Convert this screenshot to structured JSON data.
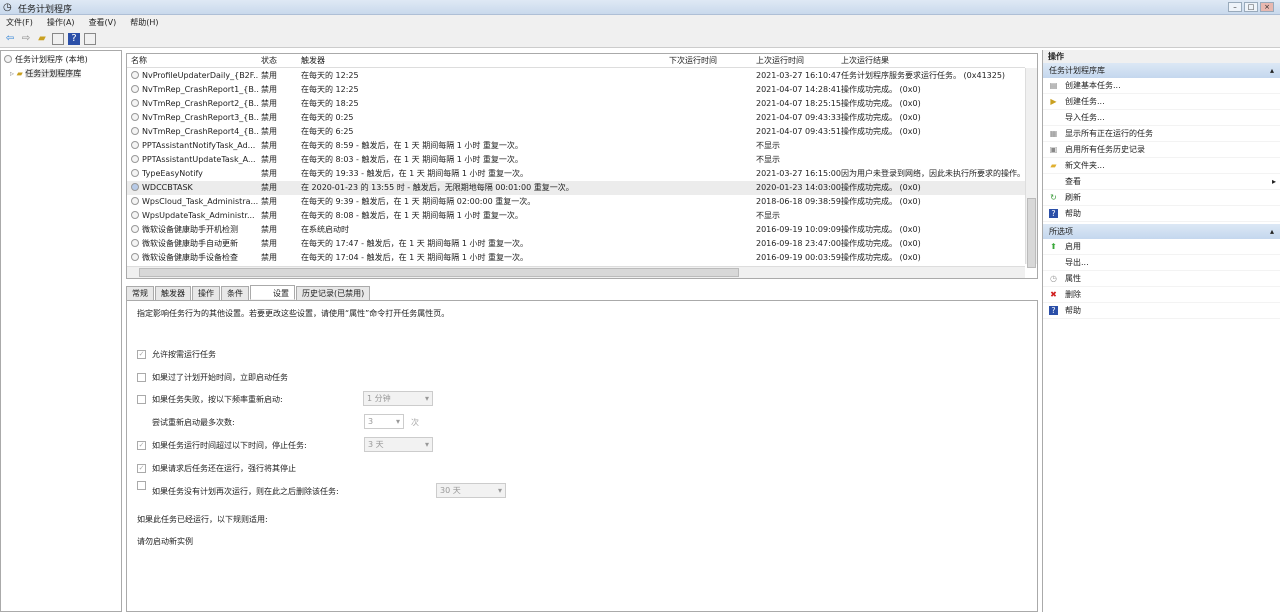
{
  "window": {
    "title": "任务计划程序"
  },
  "menu": [
    "文件(F)",
    "操作(A)",
    "查看(V)",
    "帮助(H)"
  ],
  "tree": {
    "root": "任务计划程序 (本地)",
    "child": "任务计划程序库"
  },
  "tasks": {
    "columns": [
      "名称",
      "状态",
      "触发器",
      "下次运行时间",
      "上次运行时间",
      "上次运行结果"
    ],
    "rows": [
      [
        "NvProfileUpdaterDaily_{B2F...",
        "禁用",
        "在每天的 12:25",
        "",
        "2021-03-27 16:10:47",
        "任务计划程序服务要求运行任务。 (0x41325)"
      ],
      [
        "NvTmRep_CrashReport1_{B...",
        "禁用",
        "在每天的 12:25",
        "",
        "2021-04-07 14:28:41",
        "操作成功完成。 (0x0)"
      ],
      [
        "NvTmRep_CrashReport2_{B...",
        "禁用",
        "在每天的 18:25",
        "",
        "2021-04-07 18:25:15",
        "操作成功完成。 (0x0)"
      ],
      [
        "NvTmRep_CrashReport3_{B...",
        "禁用",
        "在每天的 0:25",
        "",
        "2021-04-07 09:43:33",
        "操作成功完成。 (0x0)"
      ],
      [
        "NvTmRep_CrashReport4_{B...",
        "禁用",
        "在每天的 6:25",
        "",
        "2021-04-07 09:43:51",
        "操作成功完成。 (0x0)"
      ],
      [
        "PPTAssistantNotifyTask_Ad...",
        "禁用",
        "在每天的 8:59 - 触发后，在 1 天 期间每隔 1 小时 重复一次。",
        "",
        "不显示",
        ""
      ],
      [
        "PPTAssistantUpdateTask_A...",
        "禁用",
        "在每天的 8:03 - 触发后，在 1 天 期间每隔 1 小时 重复一次。",
        "",
        "不显示",
        ""
      ],
      [
        "TypeEasyNotify",
        "禁用",
        "在每天的 19:33 - 触发后，在 1 天 期间每隔 1 小时 重复一次。",
        "",
        "2021-03-27 16:15:00",
        "因为用户未登录到网络，因此未执行所要求的操作。"
      ],
      [
        "WDCCBTASK",
        "禁用",
        "在 2020-01-23 的 13:55 时 - 触发后，无限期地每隔 00:01:00 重复一次。",
        "",
        "2020-01-23 14:03:00",
        "操作成功完成。 (0x0)"
      ],
      [
        "WpsCloud_Task_Administra...",
        "禁用",
        "在每天的 9:39 - 触发后，在 1 天 期间每隔 02:00:00 重复一次。",
        "",
        "2018-06-18 09:38:59",
        "操作成功完成。 (0x0)"
      ],
      [
        "WpsUpdateTask_Administr...",
        "禁用",
        "在每天的 8:08 - 触发后，在 1 天 期间每隔 1 小时 重复一次。",
        "",
        "不显示",
        ""
      ],
      [
        "微软设备健康助手开机检测",
        "禁用",
        "在系统启动时",
        "",
        "2016-09-19 10:09:09",
        "操作成功完成。 (0x0)"
      ],
      [
        "微软设备健康助手自动更新",
        "禁用",
        "在每天的 17:47 - 触发后，在 1 天 期间每隔 1 小时 重复一次。",
        "",
        "2016-09-18 23:47:00",
        "操作成功完成。 (0x0)"
      ],
      [
        "微软设备健康助手设备检查",
        "禁用",
        "在每天的 17:04 - 触发后，在 1 天 期间每隔 1 小时 重复一次。",
        "",
        "2016-09-19 00:03:59",
        "操作成功完成。 (0x0)"
      ]
    ]
  },
  "tabs": [
    "常规",
    "触发器",
    "操作",
    "条件",
    "设置",
    "历史记录(已禁用)"
  ],
  "settings": {
    "intro": "指定影响任务行为的其他设置。若要更改这些设置，请使用“属性”命令打开任务属性页。",
    "allow_demand": "允许按需运行任务",
    "run_missed": "如果过了计划开始时间，立即启动任务",
    "restart_fail": "如果任务失败，按以下频率重新启动:",
    "restart_interval": "1 分钟",
    "restart_attempts_label": "尝试重新启动最多次数:",
    "restart_attempts": "3",
    "times_unit": "次",
    "stop_long": "如果任务运行时间超过以下时间，停止任务:",
    "stop_long_value": "3 天",
    "force_stop": "如果请求后任务还在运行，强行将其停止",
    "delete_if": "如果任务没有计划再次运行，则在此之后删除该任务:",
    "delete_value": "30 天",
    "rule_label": "如果此任务已经运行，以下规则适用:",
    "rule_value": "请勿启动新实例"
  },
  "actions": {
    "title": "操作",
    "section1": "任务计划程序库",
    "items1": [
      "创建基本任务...",
      "创建任务...",
      "导入任务...",
      "显示所有正在运行的任务",
      "启用所有任务历史记录",
      "新文件夹...",
      "查看",
      "刷新",
      "帮助"
    ],
    "section2": "所选项",
    "items2": [
      "启用",
      "导出...",
      "属性",
      "删除",
      "帮助"
    ]
  }
}
